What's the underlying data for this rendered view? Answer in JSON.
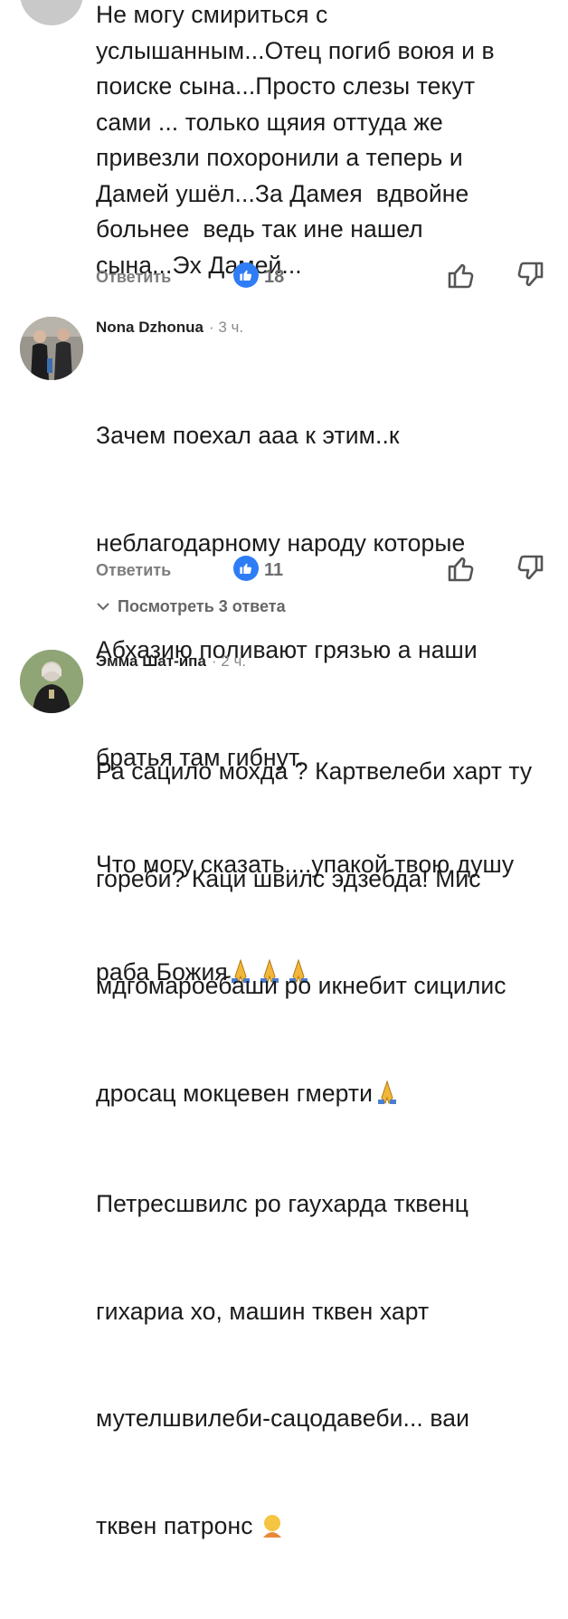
{
  "comments": [
    {
      "author": "",
      "time": "",
      "text": "Не могу смириться с\nуслышанным...Отец погиб воюя и в\nпоиске сына...Просто слезы текут\nсами ... только щяия оттуда же\nпривезли похоронили а теперь и\nДамей ушёл...За Дамея  вдвойне\nбольнее  ведь так ине нашел\nсына...Эх Дамей...",
      "reply_label": "Ответить",
      "likes": "18"
    },
    {
      "author": "Nona Dzhonua",
      "time": "· 3 ч.",
      "text_lines": [
        "Зачем поехал ааа к этим..к",
        "неблагодарному народу которые",
        "Абхазию поливают грязью а наши",
        "братья там гибнут.",
        "Что могу сказать....упакой твою душу",
        "раба Божия"
      ],
      "reply_label": "Ответить",
      "likes": "11",
      "view_replies": "Посмотреть 3 ответа"
    },
    {
      "author": "Эмма Шат-ипа",
      "time": "· 2 ч.",
      "text_lines": [
        "Ра сацило мохда ? Картвелеби харт ту",
        "гореби? Каци швилс эдзебда! Мис",
        "мдгомароебаши ро икнебит сицилис",
        "дросац мокцевен гмерти",
        "Петресшвилс ро гаухарда тквенц",
        "гихариа хо, машин тквен харт",
        "мутелшвилеби-сацодавеби... ваи",
        "тквен патронс"
      ]
    }
  ],
  "icons": {
    "like_badge": "thumbs-up-icon",
    "thumb_up": "thumbs-up-outline-icon",
    "thumb_down": "thumbs-down-outline-icon",
    "pray": "folded-hands-emoji",
    "chevron": "chevron-down-icon"
  },
  "colors": {
    "like_blue": "#2f7df6",
    "muted_text": "#7d7d7d"
  }
}
